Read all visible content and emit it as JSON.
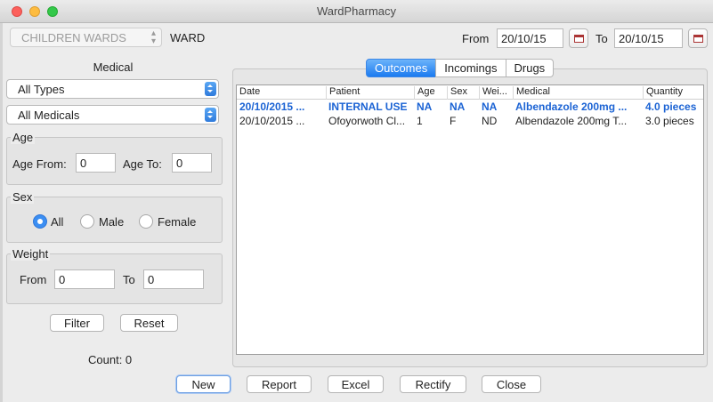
{
  "window": {
    "title": "WardPharmacy"
  },
  "ward": {
    "selected": "CHILDREN WARDS",
    "label": "WARD"
  },
  "dates": {
    "from_label": "From",
    "from_value": "20/10/15",
    "to_label": "To",
    "to_value": "20/10/15"
  },
  "medical": {
    "title": "Medical",
    "type_select": "All Types",
    "medical_select": "All Medicals"
  },
  "age": {
    "legend": "Age",
    "from_label": "Age From:",
    "from_value": "0",
    "to_label": "Age To:",
    "to_value": "0"
  },
  "sex": {
    "legend": "Sex",
    "options": [
      "All",
      "Male",
      "Female"
    ],
    "selected": "All"
  },
  "weight": {
    "legend": "Weight",
    "from_label": "From",
    "from_value": "0",
    "to_label": "To",
    "to_value": "0"
  },
  "filter_buttons": {
    "filter": "Filter",
    "reset": "Reset"
  },
  "count_text": "Count: 0",
  "tabs": [
    "Outcomes",
    "Incomings",
    "Drugs"
  ],
  "active_tab": "Outcomes",
  "table": {
    "columns": [
      "Date",
      "Patient",
      "Age",
      "Sex",
      "Wei...",
      "Medical",
      "Quantity"
    ],
    "rows": [
      [
        "20/10/2015 ...",
        "INTERNAL USE",
        "NA",
        "NA",
        "NA",
        "Albendazole 200mg ...",
        "4.0 pieces"
      ],
      [
        "20/10/2015 ...",
        "Ofoyorwoth Cl...",
        "1",
        "F",
        "ND",
        "Albendazole 200mg T...",
        "3.0 pieces"
      ]
    ]
  },
  "bottom_buttons": {
    "new": "New",
    "report": "Report",
    "excel": "Excel",
    "rectify": "Rectify",
    "close": "Close"
  },
  "colors": {
    "accent": "#1c7bf0",
    "highlight_row_text": "#1b63d4"
  }
}
